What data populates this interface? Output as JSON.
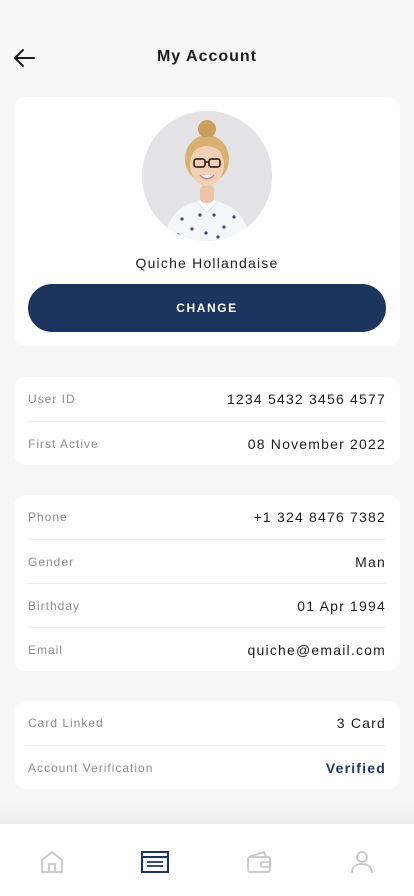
{
  "header": {
    "title": "My Account",
    "back_icon": "arrow-left-icon"
  },
  "profile": {
    "name": "Quiche Hollandaise",
    "avatar_icon": "profile-photo",
    "change_label": "CHANGE"
  },
  "account_info": [
    {
      "label": "User ID",
      "value": "1234 5432 3456 4577"
    },
    {
      "label": "First Active",
      "value": "08 November 2022"
    }
  ],
  "personal_info": [
    {
      "label": "Phone",
      "value": "+1 324 8476 7382"
    },
    {
      "label": "Gender",
      "value": "Man"
    },
    {
      "label": "Birthday",
      "value": "01 Apr 1994"
    },
    {
      "label": "Email",
      "value": "quiche@email.com"
    }
  ],
  "status_info": [
    {
      "label": "Card Linked",
      "value": "3 Card"
    },
    {
      "label": "Account Verification",
      "value": "Verified"
    }
  ],
  "tabbar": {
    "items": [
      "home-icon",
      "statement-icon",
      "wallet-icon",
      "profile-icon"
    ],
    "active": "statement-icon"
  },
  "colors": {
    "primary": "#1c355e",
    "background": "#f7f7f8",
    "card": "#ffffff",
    "label": "#8d8d8f",
    "inactive_icon": "#c6c6c8"
  }
}
